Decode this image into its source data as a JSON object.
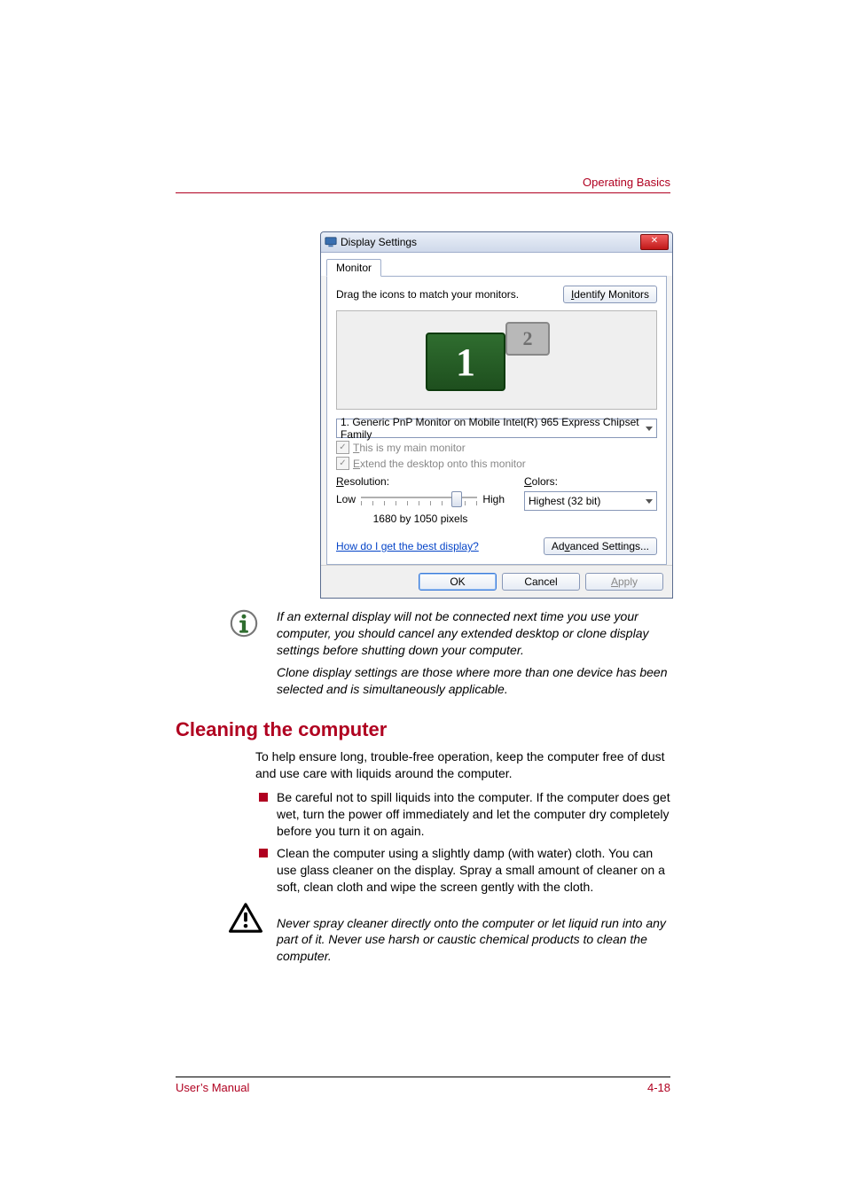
{
  "header": {
    "section": "Operating Basics"
  },
  "dialog": {
    "title": "Display Settings",
    "tab": "Monitor",
    "instruction": "Drag the icons to match your monitors.",
    "identify_btn": "Identify Monitors",
    "monitor1_num": "1",
    "monitor2_num": "2",
    "monitor_select": "1. Generic PnP Monitor on Mobile Intel(R) 965 Express Chipset Family",
    "chk_main_prefix": "T",
    "chk_main_rest": "his is my main monitor",
    "chk_extend_prefix": "E",
    "chk_extend_rest": "xtend the desktop onto this monitor",
    "res_label_prefix": "R",
    "res_label_rest": "esolution:",
    "low": "Low",
    "high": "High",
    "res_value": "1680 by 1050 pixels",
    "colors_label_prefix": "C",
    "colors_label_rest": "olors:",
    "colors_value": "Highest (32 bit)",
    "help_link": "How do I get the best display?",
    "advanced_prefix": "Ad",
    "advanced_underline": "v",
    "advanced_rest": "anced Settings...",
    "ok": "OK",
    "cancel": "Cancel",
    "apply_prefix": "A",
    "apply_rest": "pply",
    "identify_prefix": "I",
    "identify_rest": "dentify Monitors"
  },
  "note": {
    "p1": "If an external display will not be connected next time you use your computer, you should cancel any extended desktop or clone display settings before shutting down your computer.",
    "p2": "Clone display settings are those where more than one device has been selected and is simultaneously applicable."
  },
  "section_title": "Cleaning the computer",
  "intro": "To help ensure long, trouble-free operation, keep the computer free of dust and use care with liquids around the computer.",
  "bullets": [
    "Be careful not to spill liquids into the computer. If the computer does get wet, turn the power off immediately and let the computer dry completely before you turn it on again.",
    "Clean the computer using a slightly damp (with water) cloth. You can use glass cleaner on the display. Spray a small amount of cleaner on a soft, clean cloth and wipe the screen gently with the cloth."
  ],
  "caution": "Never spray cleaner directly onto the computer or let liquid run into any part of it. Never use harsh or caustic chemical products to clean the computer.",
  "footer": {
    "left": "User’s Manual",
    "right": "4-18"
  }
}
